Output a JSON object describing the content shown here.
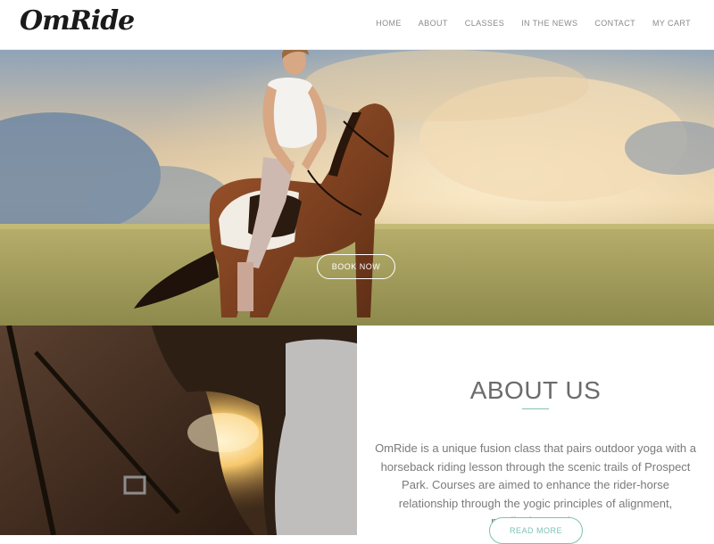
{
  "brand": {
    "logo_text": "OmRide"
  },
  "nav": {
    "items": [
      "HOME",
      "ABOUT",
      "CLASSES",
      "IN THE NEWS",
      "CONTACT",
      "MY CART"
    ]
  },
  "hero": {
    "button_label": "BOOK NOW",
    "image_subject": "rider-on-horse-in-field"
  },
  "about": {
    "title": "ABOUT US",
    "body": "OmRide is a unique fusion class that pairs outdoor yoga with a horseback riding lesson through the scenic trails of Prospect Park. Courses are aimed to enhance the rider-horse relationship through the yogic principles of alignment, meditation, and...",
    "button_label": "READ MORE"
  },
  "colors": {
    "accent": "#7cc3b2",
    "nav_text": "#8a8a8a",
    "heading": "#6b6b6b",
    "body_text": "#7a7a7a"
  }
}
